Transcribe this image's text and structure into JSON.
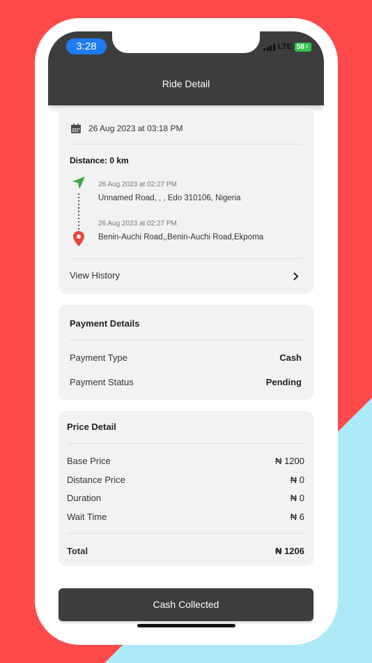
{
  "status_bar": {
    "time": "3:28",
    "network": "LTE",
    "battery": "58"
  },
  "header": {
    "title": "Ride Detail"
  },
  "ride": {
    "date": "26 Aug 2023 at 03:18 PM",
    "distance": "Distance: 0 km",
    "pickup": {
      "time": "26 Aug 2023 at 02:27 PM",
      "address": "Unnamed Road, , , Edo 310106, Nigeria"
    },
    "dropoff": {
      "time": "26 Aug 2023 at 02:27 PM",
      "address": "Benin-Auchi Road,,Benin-Auchi Road,Ekpoma"
    },
    "view_history": "View History"
  },
  "payment": {
    "title": "Payment Details",
    "type_label": "Payment Type",
    "type_value": "Cash",
    "status_label": "Payment Status",
    "status_value": "Pending"
  },
  "price": {
    "title": "Price Detail",
    "rows": [
      {
        "label": "Base Price",
        "value": "₦ 1200"
      },
      {
        "label": "Distance Price",
        "value": "₦ 0"
      },
      {
        "label": "Duration",
        "value": "₦ 0"
      },
      {
        "label": "Wait Time",
        "value": "₦ 6"
      }
    ],
    "total_label": "Total",
    "total_value": "₦ 1206"
  },
  "action": {
    "button_label": "Cash Collected"
  },
  "colors": {
    "header_bg": "#3d3d3d",
    "pickup_arrow": "#3aa843",
    "dropoff_pin": "#e8473b",
    "time_pill": "#1e7bf0",
    "battery": "#33c24d"
  }
}
